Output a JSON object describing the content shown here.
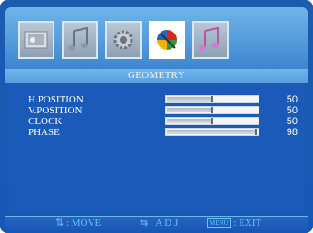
{
  "tabs": [
    {
      "icon": "picture-icon",
      "active": false
    },
    {
      "icon": "audio-icon",
      "active": false
    },
    {
      "icon": "gear-icon",
      "active": false
    },
    {
      "icon": "geometry-icon",
      "active": true
    },
    {
      "icon": "music-icon",
      "active": false
    }
  ],
  "section": {
    "title": "GEOMETRY"
  },
  "settings": [
    {
      "label": "H.POSITION",
      "value": "50",
      "level": 0.5
    },
    {
      "label": "V.POSITION",
      "value": "50",
      "level": 0.5
    },
    {
      "label": "CLOCK",
      "value": "50",
      "level": 0.5
    },
    {
      "label": "PHASE",
      "value": "98",
      "level": 0.98
    }
  ],
  "footer": {
    "move": ": MOVE",
    "adj": ": A D J",
    "menu_key": "MENU",
    "exit": ": EXIT"
  },
  "colors": {
    "panel": "#1658b8",
    "tabbar": "#5aa0e0",
    "footer_text": "#5fc8ff"
  }
}
